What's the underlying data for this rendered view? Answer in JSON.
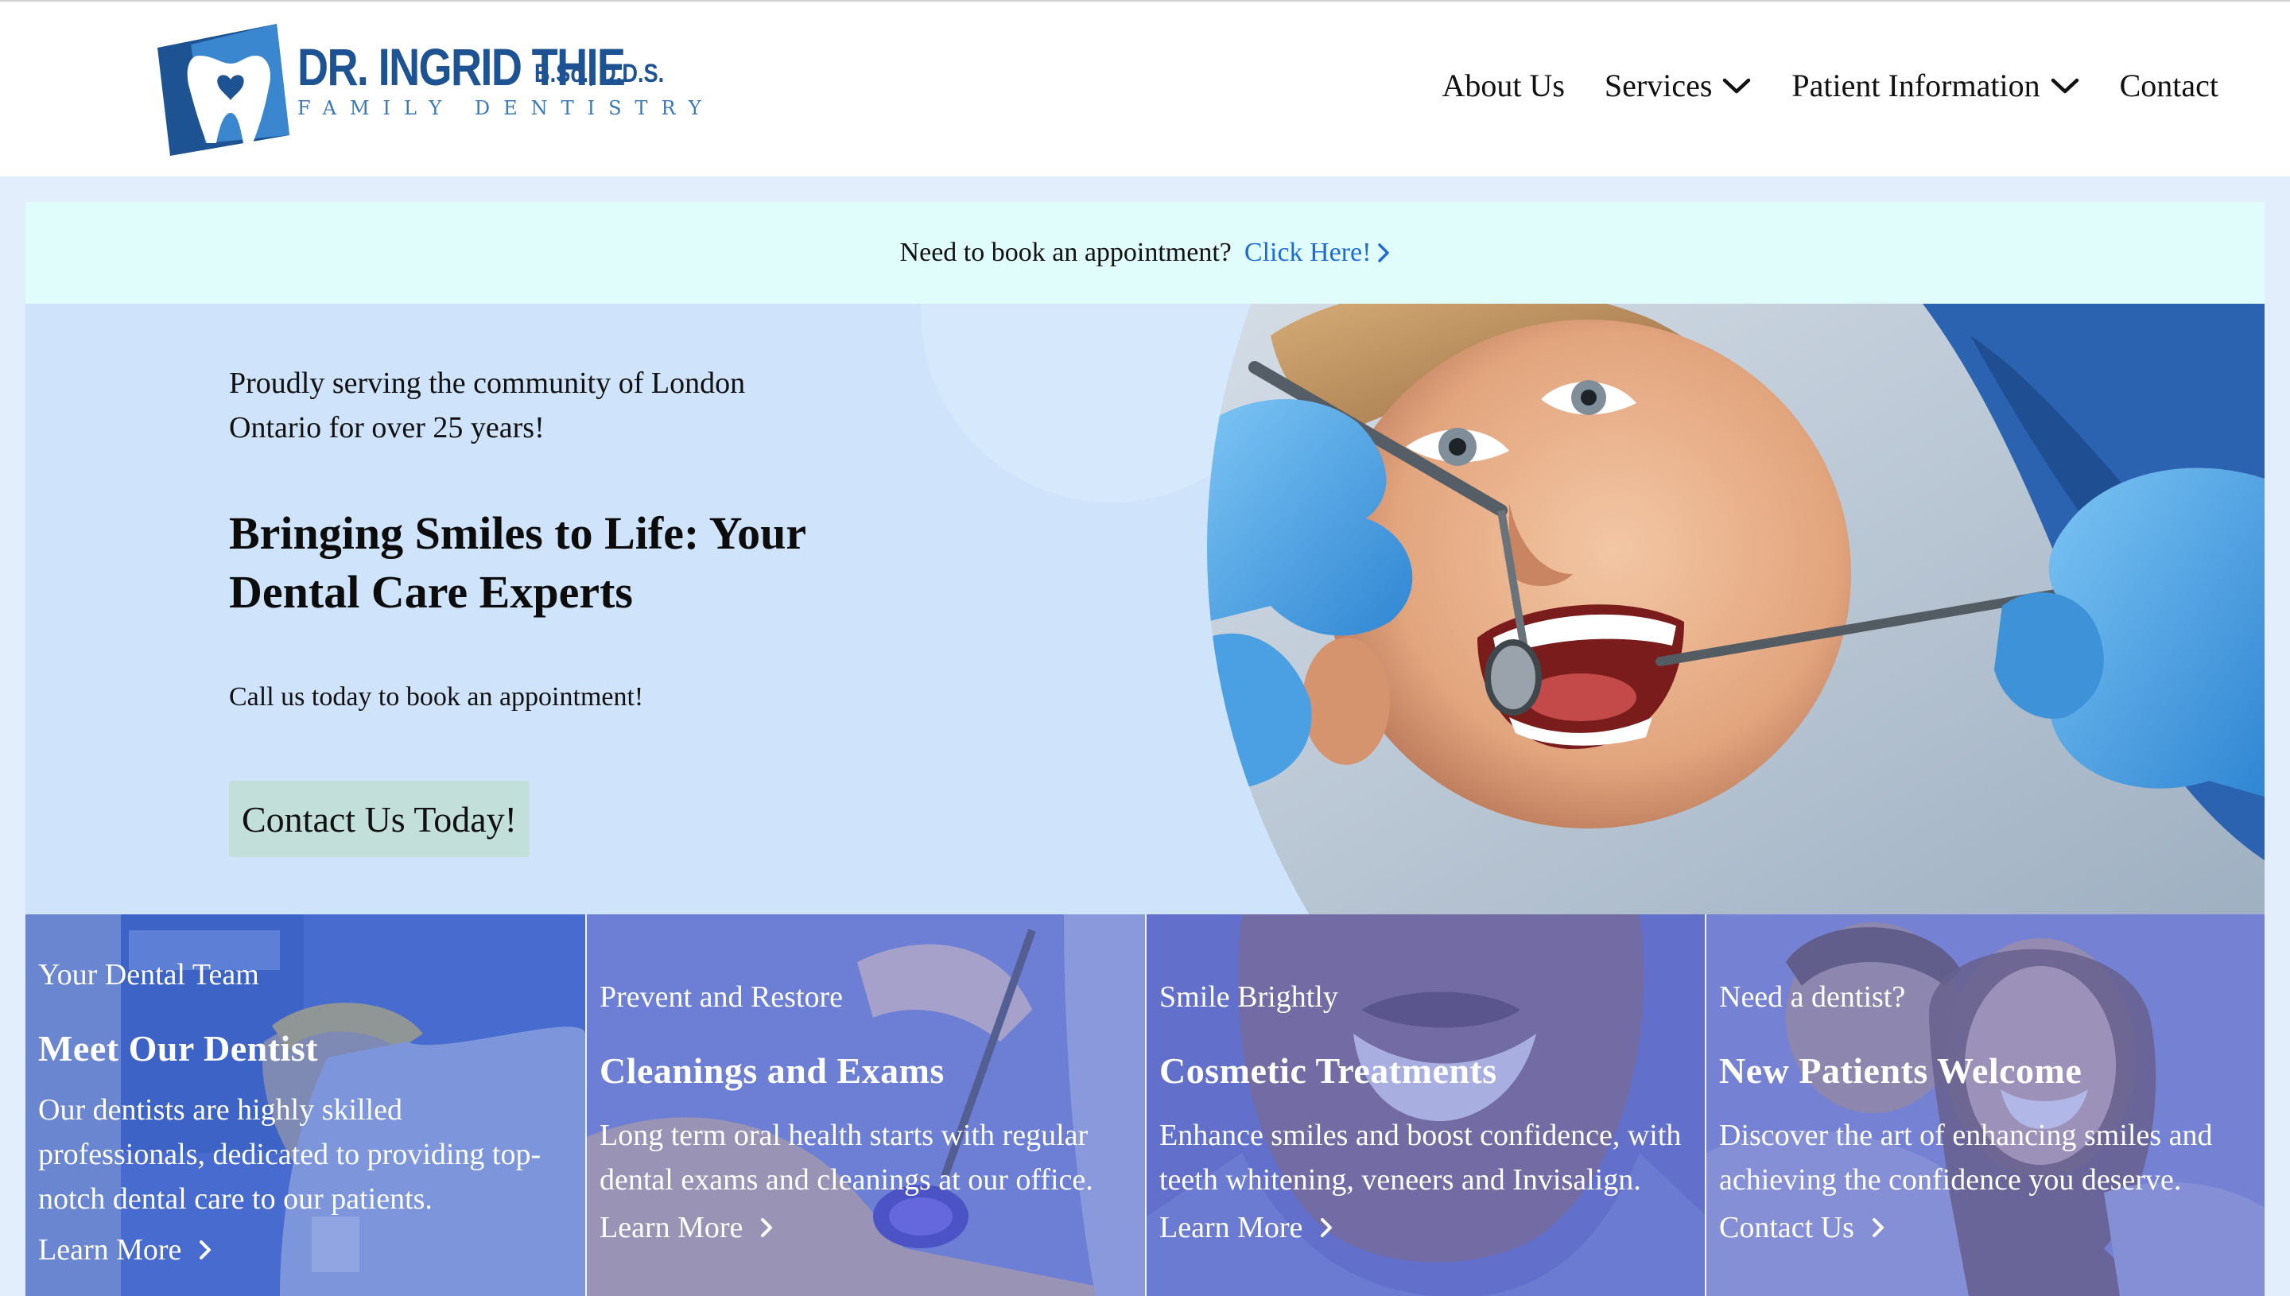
{
  "logo": {
    "name": "DR. INGRID THIE",
    "credentials": "B.Sc., D.D.S.",
    "subtitle": "FAMILY DENTISTRY"
  },
  "nav": {
    "items": [
      {
        "label": "About Us",
        "has_dropdown": false
      },
      {
        "label": "Services",
        "has_dropdown": true
      },
      {
        "label": "Patient Information",
        "has_dropdown": true
      },
      {
        "label": "Contact",
        "has_dropdown": false
      }
    ]
  },
  "banner": {
    "text": "Need to book an appointment?",
    "link": "Click Here!"
  },
  "hero": {
    "tagline": "Proudly serving the community of London Ontario for over 25 years!",
    "title": "Bringing Smiles to Life: Your Dental Care Experts",
    "call": "Call us today to book an appointment!",
    "button": "Contact Us Today!"
  },
  "cards": [
    {
      "eyebrow": "Your Dental Team",
      "title": "Meet Our Dentist",
      "text": "Our dentists are highly skilled professionals, dedicated to providing top-notch dental care to our patients.",
      "link": "Learn More"
    },
    {
      "eyebrow": "Prevent and Restore",
      "title": "Cleanings and Exams",
      "text": "Long term oral health starts with regular dental exams and cleanings at our office.",
      "link": "Learn More"
    },
    {
      "eyebrow": "Smile Brightly",
      "title": "Cosmetic Treatments",
      "text": "Enhance smiles and boost confidence, with teeth whitening, veneers and Invisalign.",
      "link": "Learn More"
    },
    {
      "eyebrow": "Need a dentist?",
      "title": "New Patients Welcome",
      "text": "Discover the art of enhancing smiles and achieving the confidence you deserve.",
      "link": "Contact Us"
    }
  ],
  "colors": {
    "brand_blue": "#1d5293",
    "link_blue": "#1e6bd6",
    "banner_bg": "#e0fdfb",
    "hero_bg": "#cfe3fb",
    "button_bg": "#c3dfd9",
    "card_overlay": "#5b78d6"
  }
}
